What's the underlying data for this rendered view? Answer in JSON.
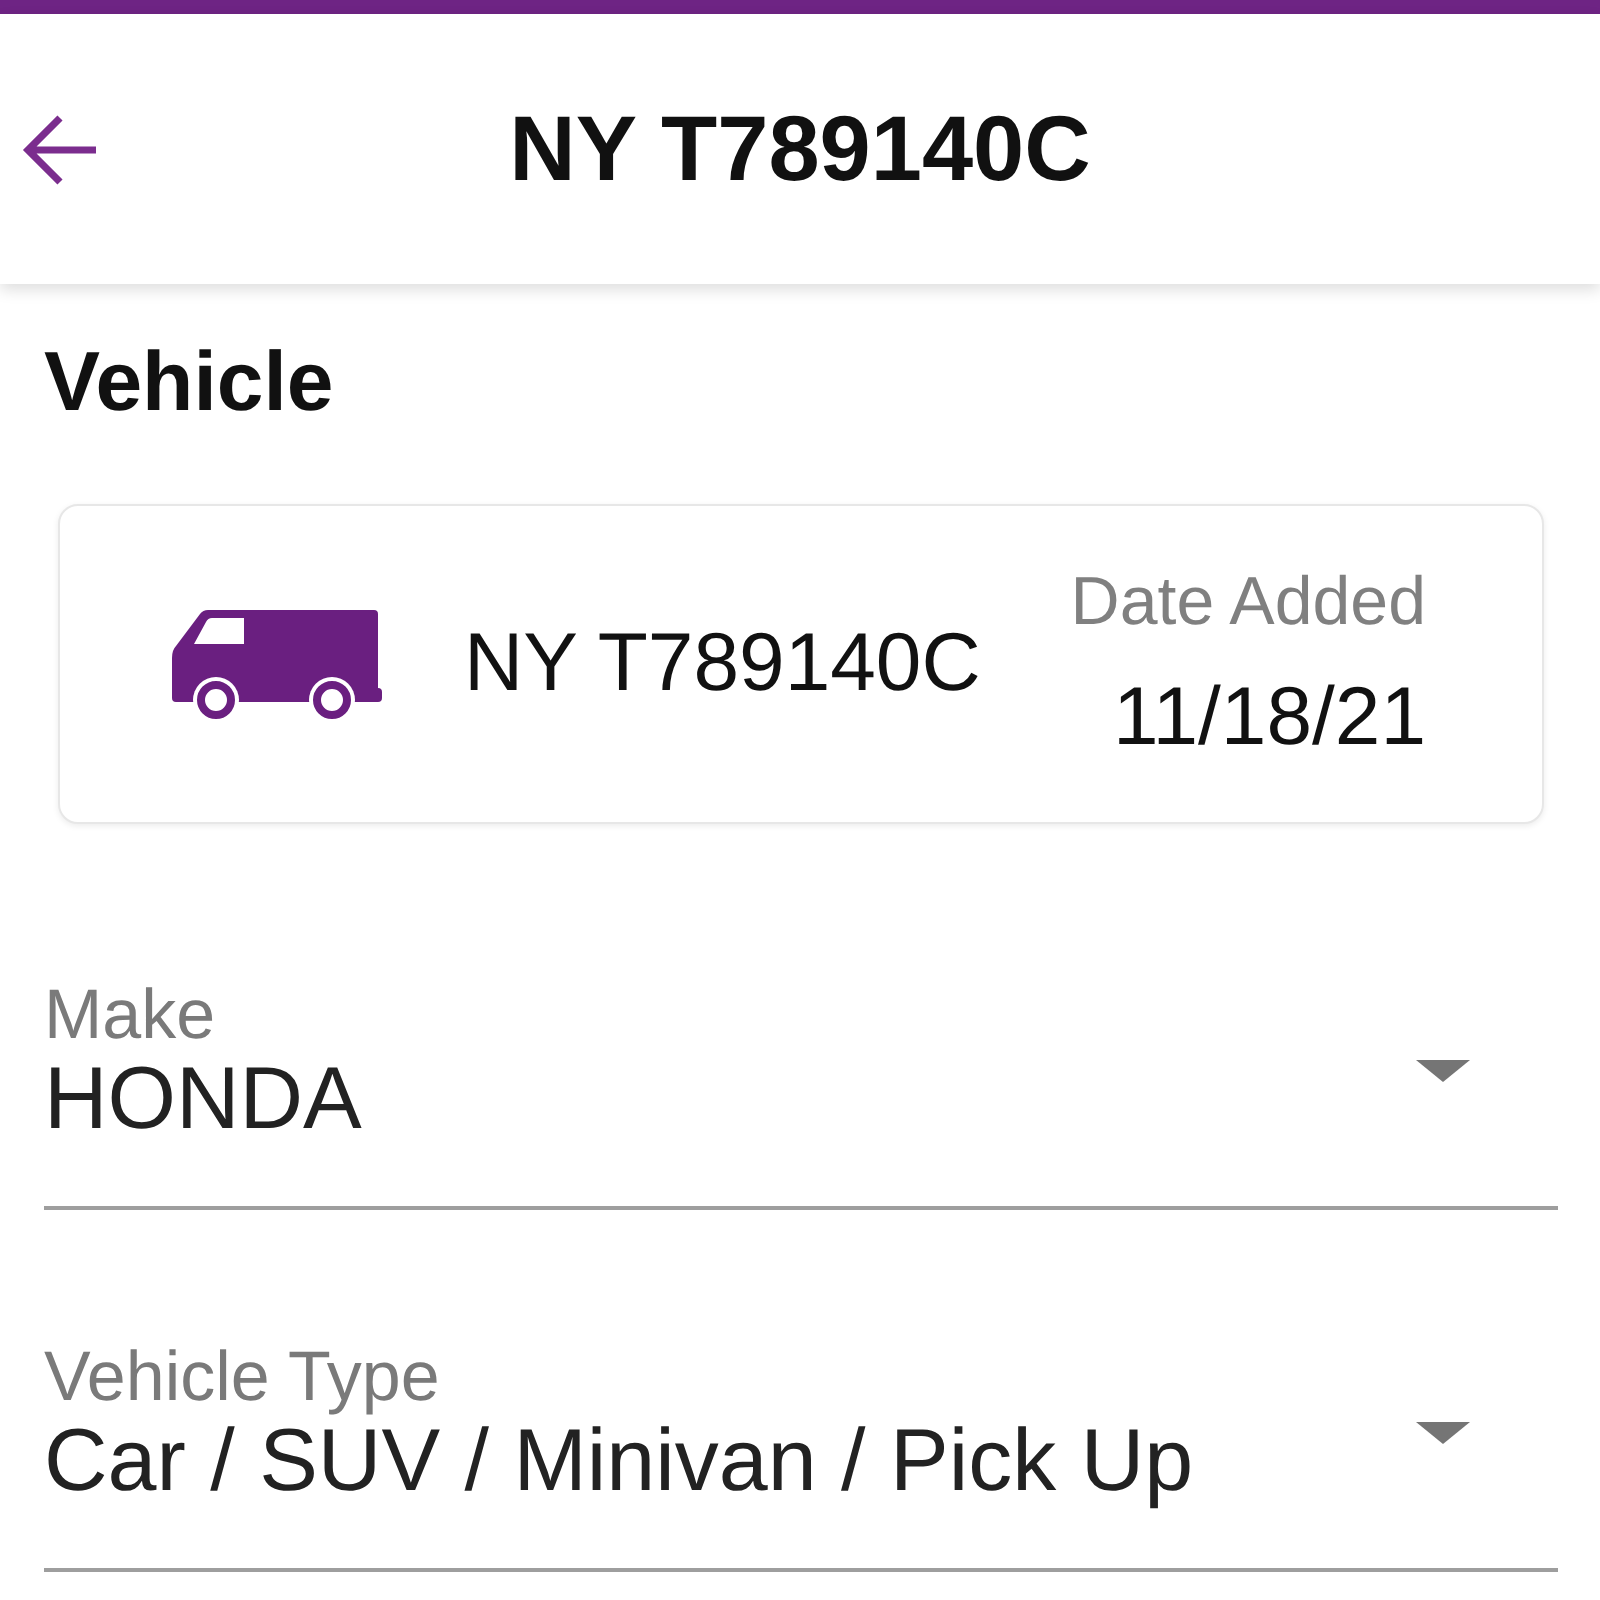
{
  "header": {
    "title": "NY T789140C"
  },
  "section": {
    "title": "Vehicle"
  },
  "vehicle_card": {
    "plate": "NY T789140C",
    "date_label": "Date Added",
    "date": "11/18/21"
  },
  "fields": [
    {
      "label": "Make",
      "value": "HONDA"
    },
    {
      "label": "Vehicle Type",
      "value": "Car / SUV / Minivan / Pick Up"
    }
  ]
}
